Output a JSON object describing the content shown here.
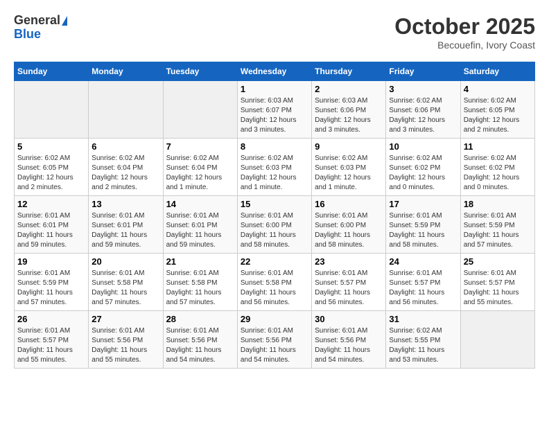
{
  "logo": {
    "general": "General",
    "blue": "Blue"
  },
  "title": "October 2025",
  "location": "Becouefin, Ivory Coast",
  "weekdays": [
    "Sunday",
    "Monday",
    "Tuesday",
    "Wednesday",
    "Thursday",
    "Friday",
    "Saturday"
  ],
  "weeks": [
    [
      {
        "day": "",
        "info": ""
      },
      {
        "day": "",
        "info": ""
      },
      {
        "day": "",
        "info": ""
      },
      {
        "day": "1",
        "info": "Sunrise: 6:03 AM\nSunset: 6:07 PM\nDaylight: 12 hours\nand 3 minutes."
      },
      {
        "day": "2",
        "info": "Sunrise: 6:03 AM\nSunset: 6:06 PM\nDaylight: 12 hours\nand 3 minutes."
      },
      {
        "day": "3",
        "info": "Sunrise: 6:02 AM\nSunset: 6:06 PM\nDaylight: 12 hours\nand 3 minutes."
      },
      {
        "day": "4",
        "info": "Sunrise: 6:02 AM\nSunset: 6:05 PM\nDaylight: 12 hours\nand 2 minutes."
      }
    ],
    [
      {
        "day": "5",
        "info": "Sunrise: 6:02 AM\nSunset: 6:05 PM\nDaylight: 12 hours\nand 2 minutes."
      },
      {
        "day": "6",
        "info": "Sunrise: 6:02 AM\nSunset: 6:04 PM\nDaylight: 12 hours\nand 2 minutes."
      },
      {
        "day": "7",
        "info": "Sunrise: 6:02 AM\nSunset: 6:04 PM\nDaylight: 12 hours\nand 1 minute."
      },
      {
        "day": "8",
        "info": "Sunrise: 6:02 AM\nSunset: 6:03 PM\nDaylight: 12 hours\nand 1 minute."
      },
      {
        "day": "9",
        "info": "Sunrise: 6:02 AM\nSunset: 6:03 PM\nDaylight: 12 hours\nand 1 minute."
      },
      {
        "day": "10",
        "info": "Sunrise: 6:02 AM\nSunset: 6:02 PM\nDaylight: 12 hours\nand 0 minutes."
      },
      {
        "day": "11",
        "info": "Sunrise: 6:02 AM\nSunset: 6:02 PM\nDaylight: 12 hours\nand 0 minutes."
      }
    ],
    [
      {
        "day": "12",
        "info": "Sunrise: 6:01 AM\nSunset: 6:01 PM\nDaylight: 11 hours\nand 59 minutes."
      },
      {
        "day": "13",
        "info": "Sunrise: 6:01 AM\nSunset: 6:01 PM\nDaylight: 11 hours\nand 59 minutes."
      },
      {
        "day": "14",
        "info": "Sunrise: 6:01 AM\nSunset: 6:01 PM\nDaylight: 11 hours\nand 59 minutes."
      },
      {
        "day": "15",
        "info": "Sunrise: 6:01 AM\nSunset: 6:00 PM\nDaylight: 11 hours\nand 58 minutes."
      },
      {
        "day": "16",
        "info": "Sunrise: 6:01 AM\nSunset: 6:00 PM\nDaylight: 11 hours\nand 58 minutes."
      },
      {
        "day": "17",
        "info": "Sunrise: 6:01 AM\nSunset: 5:59 PM\nDaylight: 11 hours\nand 58 minutes."
      },
      {
        "day": "18",
        "info": "Sunrise: 6:01 AM\nSunset: 5:59 PM\nDaylight: 11 hours\nand 57 minutes."
      }
    ],
    [
      {
        "day": "19",
        "info": "Sunrise: 6:01 AM\nSunset: 5:59 PM\nDaylight: 11 hours\nand 57 minutes."
      },
      {
        "day": "20",
        "info": "Sunrise: 6:01 AM\nSunset: 5:58 PM\nDaylight: 11 hours\nand 57 minutes."
      },
      {
        "day": "21",
        "info": "Sunrise: 6:01 AM\nSunset: 5:58 PM\nDaylight: 11 hours\nand 57 minutes."
      },
      {
        "day": "22",
        "info": "Sunrise: 6:01 AM\nSunset: 5:58 PM\nDaylight: 11 hours\nand 56 minutes."
      },
      {
        "day": "23",
        "info": "Sunrise: 6:01 AM\nSunset: 5:57 PM\nDaylight: 11 hours\nand 56 minutes."
      },
      {
        "day": "24",
        "info": "Sunrise: 6:01 AM\nSunset: 5:57 PM\nDaylight: 11 hours\nand 56 minutes."
      },
      {
        "day": "25",
        "info": "Sunrise: 6:01 AM\nSunset: 5:57 PM\nDaylight: 11 hours\nand 55 minutes."
      }
    ],
    [
      {
        "day": "26",
        "info": "Sunrise: 6:01 AM\nSunset: 5:57 PM\nDaylight: 11 hours\nand 55 minutes."
      },
      {
        "day": "27",
        "info": "Sunrise: 6:01 AM\nSunset: 5:56 PM\nDaylight: 11 hours\nand 55 minutes."
      },
      {
        "day": "28",
        "info": "Sunrise: 6:01 AM\nSunset: 5:56 PM\nDaylight: 11 hours\nand 54 minutes."
      },
      {
        "day": "29",
        "info": "Sunrise: 6:01 AM\nSunset: 5:56 PM\nDaylight: 11 hours\nand 54 minutes."
      },
      {
        "day": "30",
        "info": "Sunrise: 6:01 AM\nSunset: 5:56 PM\nDaylight: 11 hours\nand 54 minutes."
      },
      {
        "day": "31",
        "info": "Sunrise: 6:02 AM\nSunset: 5:55 PM\nDaylight: 11 hours\nand 53 minutes."
      },
      {
        "day": "",
        "info": ""
      }
    ]
  ]
}
